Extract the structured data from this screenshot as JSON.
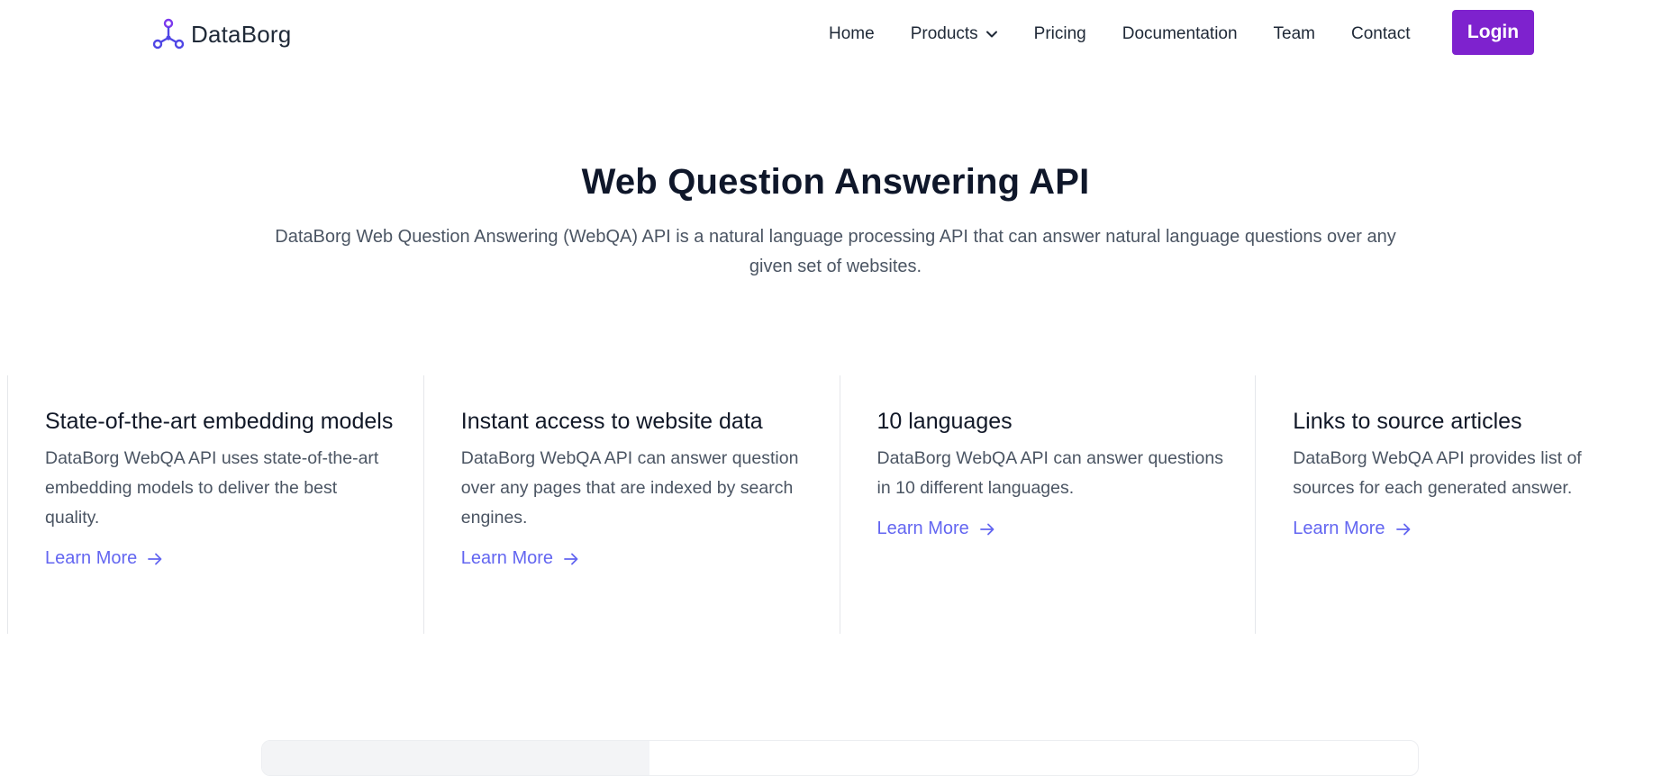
{
  "nav": {
    "brand": "DataBorg",
    "items": [
      {
        "label": "Home"
      },
      {
        "label": "Products",
        "has_dropdown": true
      },
      {
        "label": "Pricing"
      },
      {
        "label": "Documentation"
      },
      {
        "label": "Team"
      },
      {
        "label": "Contact"
      }
    ],
    "login_label": "Login"
  },
  "hero": {
    "title": "Web Question Answering API",
    "description": "DataBorg Web Question Answering (WebQA) API is a natural language processing API that can answer natural language questions over any given set of websites."
  },
  "features": [
    {
      "title": "State-of-the-art embedding models",
      "description": "DataBorg WebQA API uses state-of-the-art embedding models to deliver the best quality.",
      "link": "Learn More"
    },
    {
      "title": "Instant access to website data",
      "description": "DataBorg WebQA API can answer question over any pages that are indexed by search engines.",
      "link": "Learn More"
    },
    {
      "title": "10 languages",
      "description": "DataBorg WebQA API can answer questions in 10 different languages.",
      "link": "Learn More"
    },
    {
      "title": "Links to source articles",
      "description": "DataBorg WebQA API provides list of sources for each generated answer.",
      "link": "Learn More"
    }
  ],
  "colors": {
    "accent": "#7e22ce",
    "link": "#6366f1",
    "logo": "#4f46e5"
  },
  "icons": {
    "logo": "molecule-nodes-icon",
    "dropdown": "chevron-down-icon",
    "learn_more": "arrow-right-icon"
  }
}
